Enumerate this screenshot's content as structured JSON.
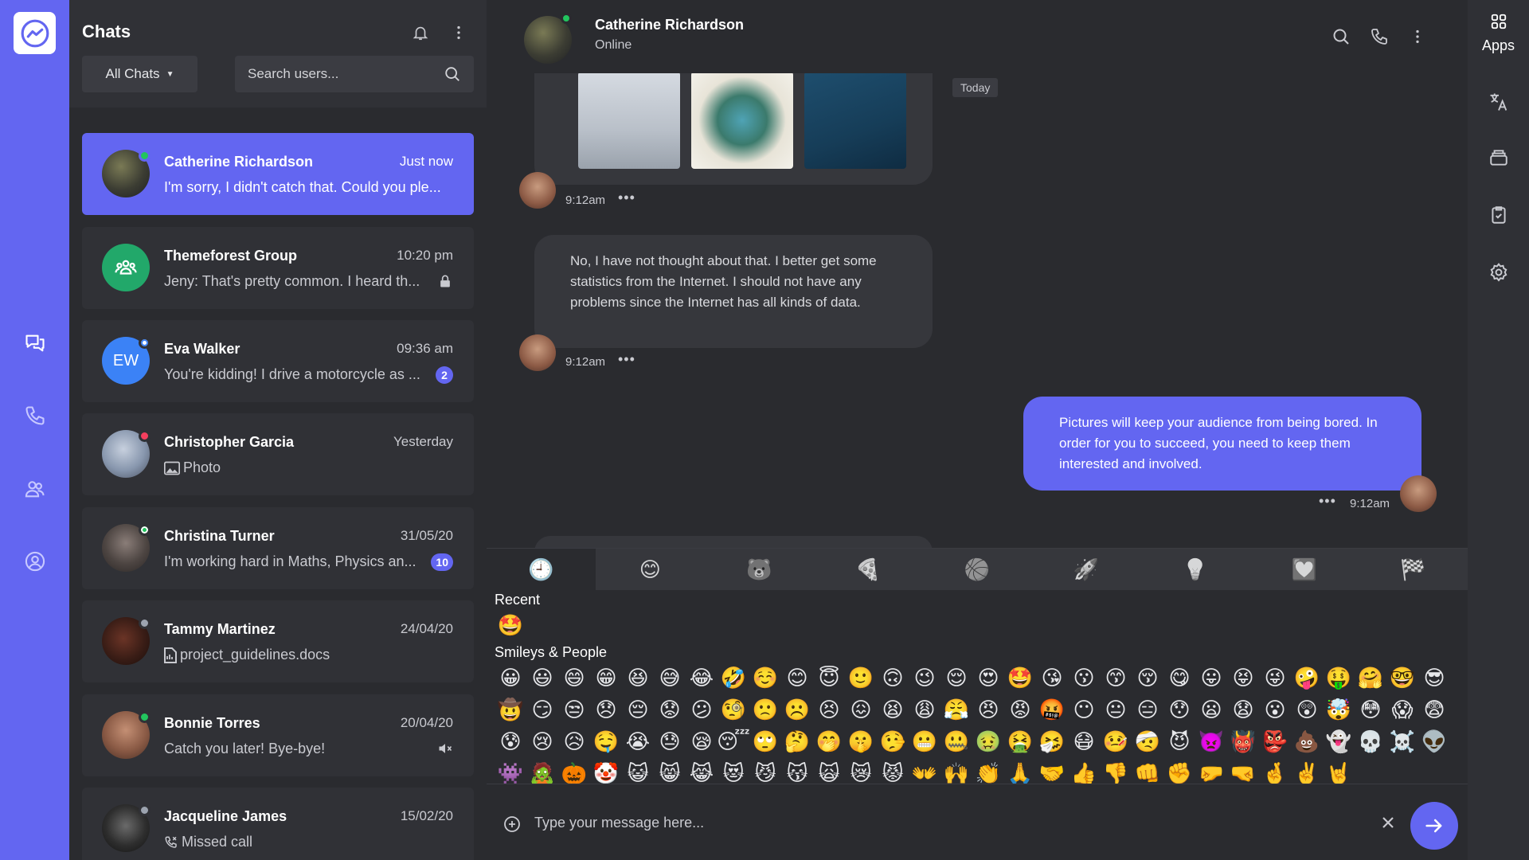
{
  "nav": {
    "items": [
      "chats",
      "calls",
      "contacts",
      "profile"
    ]
  },
  "chat_list": {
    "title": "Chats",
    "filter_label": "All Chats",
    "search_placeholder": "Search users...",
    "items": [
      {
        "name": "Catherine Richardson",
        "time": "Just now",
        "preview": "I'm sorry, I didn't catch that. Could you ple...",
        "status_color": "#22c55e",
        "active": true
      },
      {
        "name": "Themeforest Group",
        "time": "10:20 pm",
        "preview": "Jeny: That's pretty common. I heard th...",
        "icon": "lock-icon"
      },
      {
        "name": "Eva Walker",
        "initials": "EW",
        "time": "09:36 am",
        "preview": "You're kidding! I drive a motorcycle as ...",
        "badge": "2",
        "status_color": "#ffffff"
      },
      {
        "name": "Christopher Garcia",
        "time": "Yesterday",
        "preview": "Photo",
        "status_color": "#f43f5e",
        "preview_icon": "image-icon"
      },
      {
        "name": "Christina Turner",
        "time": "31/05/20",
        "preview": "I'm working hard in Maths, Physics an...",
        "badge": "10",
        "status_color": "#22c55e"
      },
      {
        "name": "Tammy Martinez",
        "time": "24/04/20",
        "preview": "project_guidelines.docs",
        "status_color": "#9ca3af",
        "preview_icon": "file-icon"
      },
      {
        "name": "Bonnie Torres",
        "time": "20/04/20",
        "preview": "Catch you later! Bye-bye!",
        "status_color": "#22c55e",
        "icon": "mute-icon"
      },
      {
        "name": "Jacqueline James",
        "time": "15/02/20",
        "preview": "Missed call",
        "status_color": "#9ca3af",
        "preview_icon": "missed-call-icon"
      }
    ]
  },
  "conversation": {
    "contact_name": "Catherine Richardson",
    "contact_status": "Online",
    "date_divider": "Today",
    "messages": [
      {
        "type": "images",
        "time": "9:12am"
      },
      {
        "type": "text",
        "direction": "in",
        "text": "No, I have not thought about that. I better get some statistics from the Internet. I should not have any problems since the Internet has all kinds of data.",
        "time": "9:12am"
      },
      {
        "type": "text",
        "direction": "out",
        "text": "Pictures will keep your audience from being bored. In order for you to succeed, you need to keep them interested and involved.",
        "time": "9:12am"
      }
    ]
  },
  "emoji_picker": {
    "tabs": [
      "🕘",
      "😊",
      "🐻",
      "🍕",
      "🏀",
      "🚀",
      "💡",
      "💟",
      "🏁"
    ],
    "recent_label": "Recent",
    "recent": [
      "🤩"
    ],
    "smileys_label": "Smileys & People",
    "smileys": [
      "😀",
      "😃",
      "😄",
      "😁",
      "😆",
      "😅",
      "😂",
      "🤣",
      "☺️",
      "😊",
      "😇",
      "🙂",
      "🙃",
      "😉",
      "😌",
      "😍",
      "🤩",
      "😘",
      "😗",
      "😙",
      "😚",
      "😋",
      "😛",
      "😝",
      "😜",
      "🤪",
      "🤑",
      "🤗",
      "🤓",
      "😎",
      "🤠",
      "😏",
      "😒",
      "😞",
      "😔",
      "😟",
      "😕",
      "🧐",
      "🙁",
      "☹️",
      "😣",
      "😖",
      "😫",
      "😩",
      "😤",
      "😠",
      "😡",
      "🤬",
      "😶",
      "😐",
      "😑",
      "😯",
      "😦",
      "😧",
      "😮",
      "😲",
      "🤯",
      "😳",
      "😱",
      "😨",
      "😰",
      "😢",
      "😥",
      "🤤",
      "😭",
      "😓",
      "😪",
      "😴",
      "🙄",
      "🤔",
      "🤭",
      "🤫",
      "🤥",
      "😬",
      "🤐",
      "🤢",
      "🤮",
      "🤧",
      "😷",
      "🤒",
      "🤕",
      "😈",
      "👿",
      "👹",
      "👺",
      "💩",
      "👻",
      "💀",
      "☠️",
      "👽",
      "👾",
      "🧟",
      "🎃",
      "🤡",
      "😺",
      "😸",
      "😹",
      "😻",
      "😼",
      "😽",
      "🙀",
      "😿",
      "😾",
      "👐",
      "🙌",
      "👏",
      "🙏",
      "🤝",
      "👍",
      "👎",
      "👊",
      "✊",
      "🤛",
      "🤜",
      "🤞",
      "✌️",
      "🤘"
    ]
  },
  "composer": {
    "placeholder": "Type your message here..."
  },
  "right_rail": {
    "apps_label": "Apps"
  },
  "colors": {
    "accent": "#6366f1",
    "panel": "#303136",
    "background": "#2a2b2f",
    "online": "#22c55e"
  }
}
